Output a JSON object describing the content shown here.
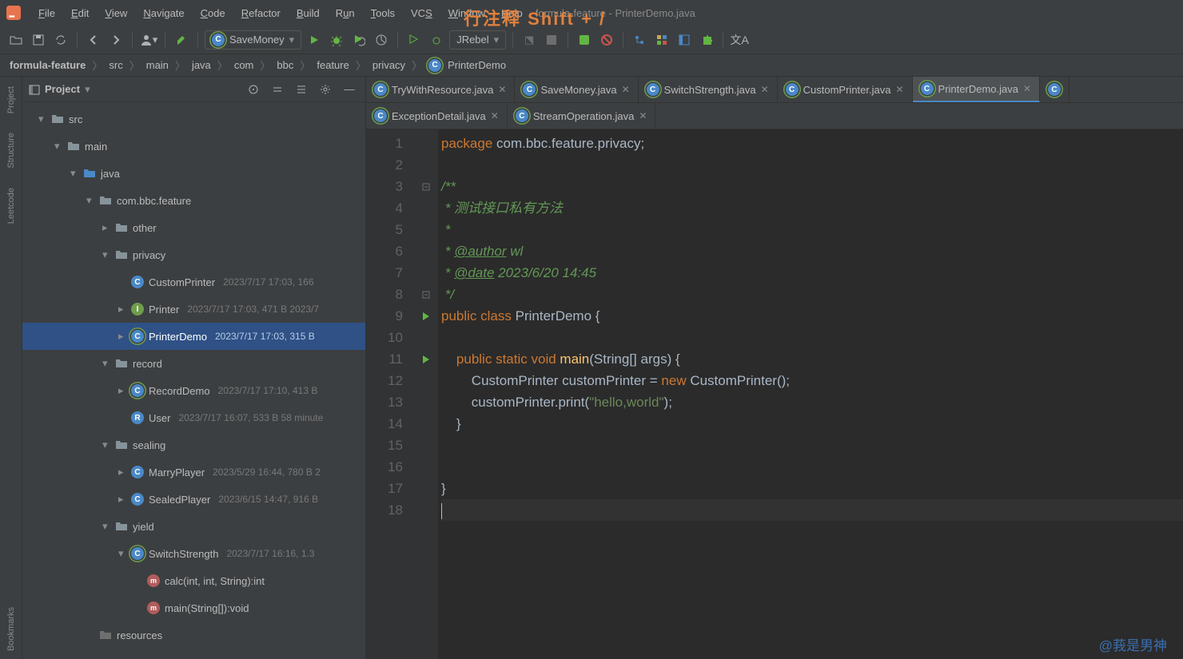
{
  "window": {
    "title_suffix": "formula-feature - PrinterDemo.java"
  },
  "overlay": "行注释 Shift + /",
  "menu": [
    "File",
    "Edit",
    "View",
    "Navigate",
    "Code",
    "Refactor",
    "Build",
    "Run",
    "Tools",
    "VCS",
    "Window",
    "Help"
  ],
  "run_config": "SaveMoney",
  "jrebel": "JRebel",
  "breadcrumb": [
    "formula-feature",
    "src",
    "main",
    "java",
    "com",
    "bbc",
    "feature",
    "privacy",
    "PrinterDemo"
  ],
  "panel": {
    "title": "Project"
  },
  "tree": [
    {
      "depth": 0,
      "arrow": "▾",
      "icon": "folder",
      "label": "src",
      "meta": ""
    },
    {
      "depth": 1,
      "arrow": "▾",
      "icon": "folder",
      "label": "main",
      "meta": ""
    },
    {
      "depth": 2,
      "arrow": "▾",
      "icon": "folder-blue",
      "label": "java",
      "meta": ""
    },
    {
      "depth": 3,
      "arrow": "▾",
      "icon": "folder",
      "label": "com.bbc.feature",
      "meta": ""
    },
    {
      "depth": 4,
      "arrow": "▸",
      "icon": "folder",
      "label": "other",
      "meta": ""
    },
    {
      "depth": 4,
      "arrow": "▾",
      "icon": "folder",
      "label": "privacy",
      "meta": ""
    },
    {
      "depth": 5,
      "arrow": "",
      "icon": "class",
      "label": "CustomPrinter",
      "meta": "2023/7/17 17:03, 166"
    },
    {
      "depth": 5,
      "arrow": "▸",
      "icon": "interface",
      "label": "Printer",
      "meta": "2023/7/17 17:03, 471 B 2023/7"
    },
    {
      "depth": 5,
      "arrow": "▸",
      "icon": "class-run",
      "label": "PrinterDemo",
      "meta": "2023/7/17 17:03, 315 B",
      "selected": true
    },
    {
      "depth": 4,
      "arrow": "▾",
      "icon": "folder",
      "label": "record",
      "meta": ""
    },
    {
      "depth": 5,
      "arrow": "▸",
      "icon": "class-run",
      "label": "RecordDemo",
      "meta": "2023/7/17 17:10, 413 B"
    },
    {
      "depth": 5,
      "arrow": "",
      "icon": "record",
      "label": "User",
      "meta": "2023/7/17 16:07, 533 B 58 minute"
    },
    {
      "depth": 4,
      "arrow": "▾",
      "icon": "folder",
      "label": "sealing",
      "meta": ""
    },
    {
      "depth": 5,
      "arrow": "▸",
      "icon": "class",
      "label": "MarryPlayer",
      "meta": "2023/5/29 16:44, 780 B 2"
    },
    {
      "depth": 5,
      "arrow": "▸",
      "icon": "class",
      "label": "SealedPlayer",
      "meta": "2023/6/15 14:47, 916 B"
    },
    {
      "depth": 4,
      "arrow": "▾",
      "icon": "folder",
      "label": "yield",
      "meta": ""
    },
    {
      "depth": 5,
      "arrow": "▾",
      "icon": "class-run",
      "label": "SwitchStrength",
      "meta": "2023/7/17 16:16, 1.3"
    },
    {
      "depth": 6,
      "arrow": "",
      "icon": "method",
      "label": "calc(int, int, String):int",
      "meta": ""
    },
    {
      "depth": 6,
      "arrow": "",
      "icon": "method",
      "label": "main(String[]):void",
      "meta": ""
    },
    {
      "depth": 3,
      "arrow": "",
      "icon": "folder-dim",
      "label": "resources",
      "meta": ""
    }
  ],
  "tabs_row1": [
    {
      "label": "TryWithResource.java"
    },
    {
      "label": "SaveMoney.java"
    },
    {
      "label": "SwitchStrength.java"
    },
    {
      "label": "CustomPrinter.java"
    },
    {
      "label": "PrinterDemo.java",
      "active": true
    }
  ],
  "tabs_row2": [
    {
      "label": "ExceptionDetail.java"
    },
    {
      "label": "StreamOperation.java"
    }
  ],
  "code": {
    "package_kw": "package",
    "package_name": "com.bbc.feature.privacy",
    "doc_open": "/**",
    "doc_l1": " * 测试接口私有方法",
    "doc_l2": " *",
    "doc_l3_pre": " * ",
    "doc_author_tag": "@author",
    "doc_author_val": " wl",
    "doc_l4_pre": " * ",
    "doc_date_tag": "@date",
    "doc_date_val": " 2023/6/20 14:45",
    "doc_close": " */",
    "public": "public",
    "class": "class",
    "classname": "PrinterDemo",
    "static": "static",
    "void": "void",
    "main": "main",
    "args": "(String[] args) {",
    "line12_a": "CustomPrinter customPrinter = ",
    "new": "new",
    "line12_b": " CustomPrinter();",
    "line13_a": "customPrinter.print(",
    "line13_str": "\"hello,world\"",
    "line13_b": ");",
    "brace_close": "}",
    "line_nums": [
      "1",
      "2",
      "3",
      "4",
      "5",
      "6",
      "7",
      "8",
      "9",
      "10",
      "11",
      "12",
      "13",
      "14",
      "15",
      "16",
      "17",
      "18"
    ]
  },
  "left_tools": [
    "Project",
    "Structure",
    "Leetcode",
    "Bookmarks"
  ],
  "watermark": "@莪是男神"
}
